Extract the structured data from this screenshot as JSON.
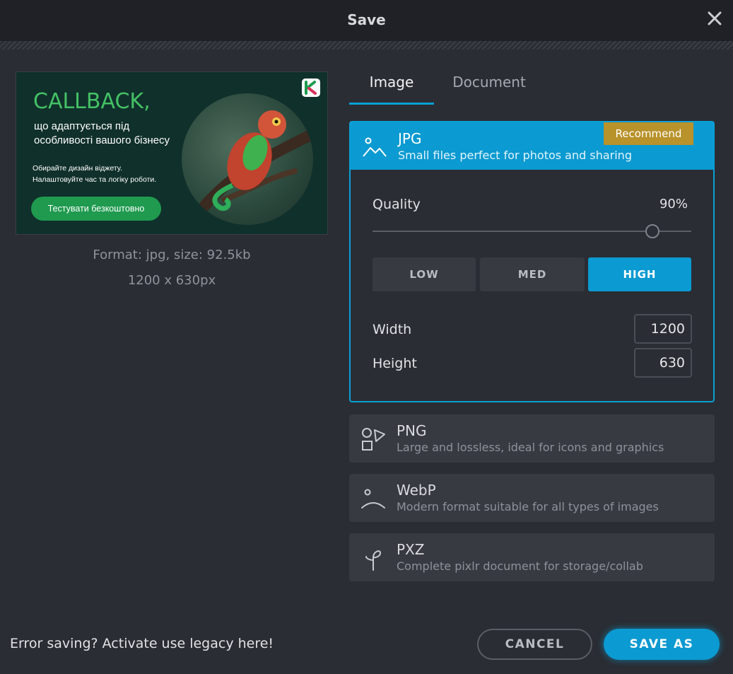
{
  "dialog": {
    "title": "Save"
  },
  "preview": {
    "headline": "CALLBACK,",
    "line1": "що адаптується під",
    "line2": "особливості вашого бізнесу",
    "small1": "Обирайте дизайн віджету.",
    "small2": "Налаштовуйте час та логіку роботи.",
    "cta": "Тестувати безкоштовно",
    "format_info": "Format: jpg, size: 92.5kb",
    "dimensions": "1200 x 630px"
  },
  "tabs": [
    {
      "label": "Image",
      "active": true
    },
    {
      "label": "Document",
      "active": false
    }
  ],
  "formats": {
    "jpg": {
      "title": "JPG",
      "description": "Small files perfect for photos and sharing",
      "badge": "Recommend",
      "icon": "image-icon"
    },
    "png": {
      "title": "PNG",
      "description": "Large and lossless, ideal for icons and graphics",
      "icon": "shapes-icon"
    },
    "webp": {
      "title": "WebP",
      "description": "Modern format suitable for all types of images",
      "icon": "webp-icon"
    },
    "pxz": {
      "title": "PXZ",
      "description": "Complete pixlr document for storage/collab",
      "icon": "pxz-icon"
    }
  },
  "quality": {
    "label": "Quality",
    "value_text": "90%",
    "value": 0.9,
    "presets": [
      "LOW",
      "MED",
      "HIGH"
    ],
    "selected": "HIGH"
  },
  "size": {
    "width_label": "Width",
    "width": "1200",
    "height_label": "Height",
    "height": "630"
  },
  "footer": {
    "legacy": "Error saving? Activate use legacy here!",
    "cancel": "CANCEL",
    "save_as": "SAVE AS"
  },
  "colors": {
    "accent": "#0b9ad1",
    "badge": "#b8922a",
    "background": "#2a2d33"
  }
}
